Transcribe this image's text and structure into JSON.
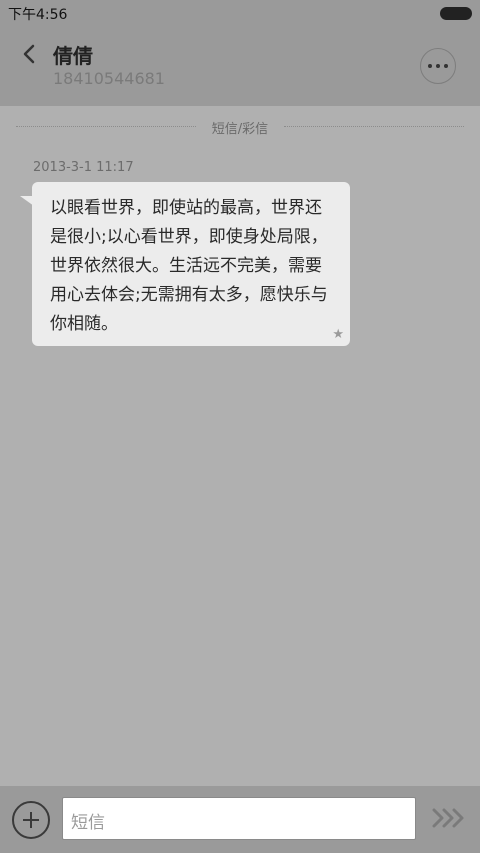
{
  "status": {
    "time": "下午4:56"
  },
  "header": {
    "title": "倩倩",
    "subtitle": "18410544681"
  },
  "conversation": {
    "divider_label": "短信/彩信",
    "messages": [
      {
        "timestamp": "2013-3-1 11:17",
        "text": "以眼看世界，即使站的最高，世界还是很小;以心看世界，即使身处局限，世界依然很大。生活远不完美，需要用心去体会;无需拥有太多，愿快乐与你相随。",
        "star": "★"
      }
    ]
  },
  "composer": {
    "placeholder": "短信"
  }
}
